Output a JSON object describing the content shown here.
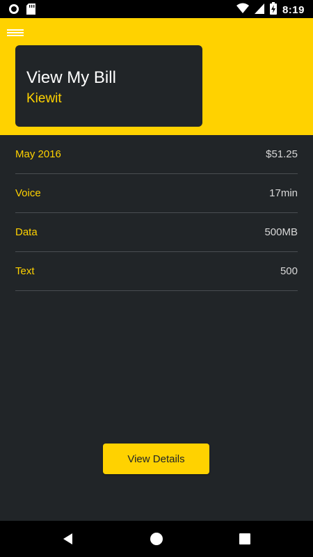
{
  "status_bar": {
    "time": "8:19",
    "icons": [
      "circle-status-icon",
      "sd-card-icon",
      "wifi-icon",
      "signal-icon",
      "battery-charging-icon"
    ]
  },
  "header": {
    "menu_icon": "hamburger-menu-icon",
    "title": "View My Bill",
    "subtitle": "Kiewit"
  },
  "bill": {
    "rows": [
      {
        "label": "May 2016",
        "value": "$51.25"
      },
      {
        "label": "Voice",
        "value": "17min"
      },
      {
        "label": "Data",
        "value": "500MB"
      },
      {
        "label": "Text",
        "value": "500"
      }
    ]
  },
  "actions": {
    "view_details_label": "View Details"
  },
  "nav_bar": {
    "icons": [
      "back-icon",
      "home-icon",
      "recents-icon"
    ]
  },
  "colors": {
    "accent": "#FFD200",
    "background": "#212528",
    "divider": "#4a4e52",
    "value_text": "#d8d8d8"
  }
}
